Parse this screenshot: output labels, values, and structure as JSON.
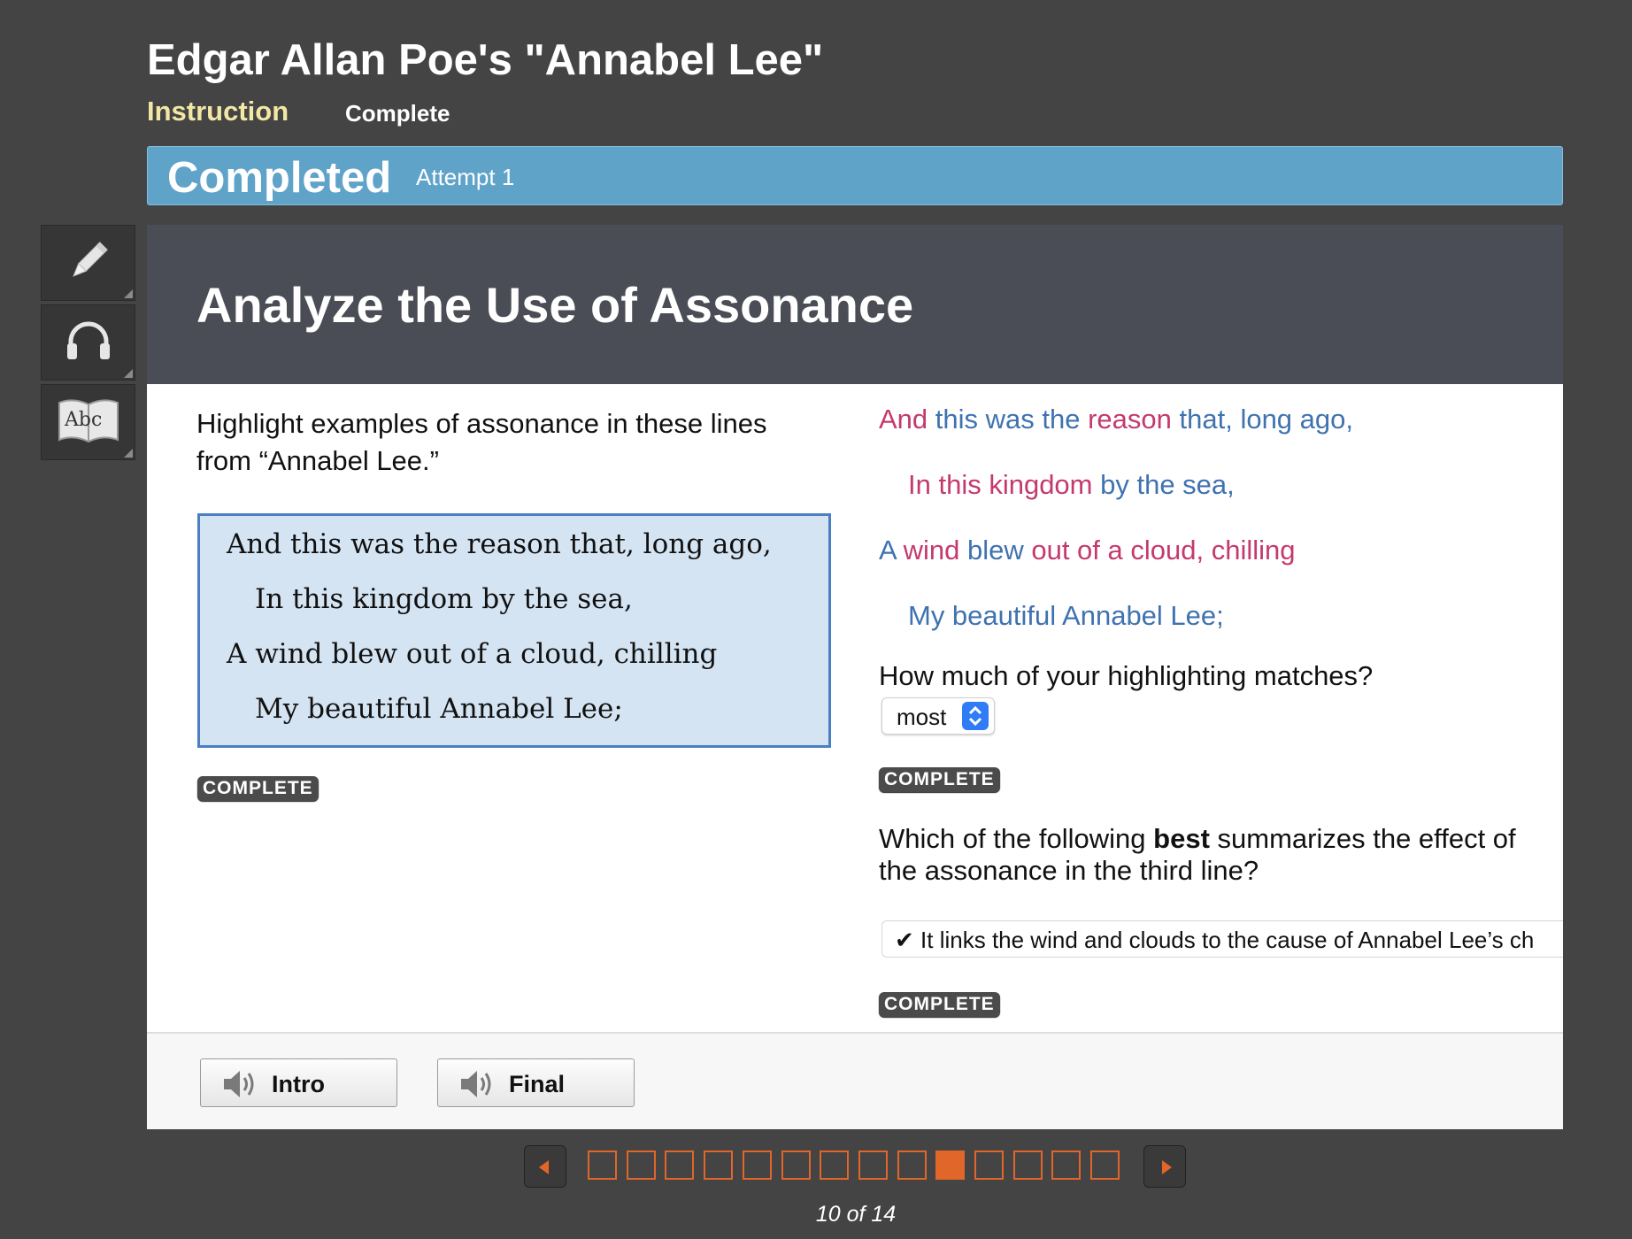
{
  "header": {
    "title": "Edgar Allan Poe's \"Annabel Lee\"",
    "tabs": [
      {
        "label": "Instruction",
        "active": true
      },
      {
        "label": "Complete",
        "active": false
      }
    ]
  },
  "status": {
    "title": "Completed",
    "attempt": "Attempt 1",
    "color": "#5fa3c9"
  },
  "toolbar": {
    "tools": [
      {
        "icon": "pencil-icon"
      },
      {
        "icon": "headphones-icon"
      },
      {
        "icon": "dictionary-icon",
        "glyph": "Abc"
      }
    ]
  },
  "lesson": {
    "title": "Analyze the Use of Assonance",
    "instruction": "Highlight examples of assonance in these lines from “Annabel Lee.”",
    "poem_lines": [
      "And this was the reason that, long ago,",
      "In this kingdom by the sea,",
      "A wind blew out of a cloud, chilling",
      "My beautiful Annabel Lee;"
    ],
    "complete_badge": "COMPLETE"
  },
  "highlighted_answer": {
    "colors": {
      "blue": "#3f72b0",
      "pink": "#c43a6c"
    },
    "lines": [
      [
        {
          "text": "And",
          "color": "pink"
        },
        {
          "text": " this was the ",
          "color": "blue"
        },
        {
          "text": "reason",
          "color": "pink"
        },
        {
          "text": " that,",
          "color": "blue"
        },
        {
          "text": " long ago,",
          "color": "blue"
        }
      ],
      [
        {
          "text": "In this kingdom",
          "color": "pink"
        },
        {
          "text": " by the sea,",
          "color": "blue"
        }
      ],
      [
        {
          "text": "A",
          "color": "blue"
        },
        {
          "text": " wind",
          "color": "pink"
        },
        {
          "text": " blew",
          "color": "blue"
        },
        {
          "text": " out of a cloud,",
          "color": "pink"
        },
        {
          "text": " chilling",
          "color": "pink"
        }
      ],
      [
        {
          "text": "My beautiful Annabel Lee;",
          "color": "blue"
        }
      ]
    ]
  },
  "question1": {
    "text": "How much of your highlighting matches?",
    "selected": "most",
    "badge": "COMPLETE"
  },
  "question2": {
    "text_before": "Which of the following ",
    "text_bold": "best",
    "text_after": " summarizes the effect of the assonance in the third line?",
    "answer_check": "✔",
    "answer": "It links the wind and clouds to the cause of Annabel Lee’s ch",
    "badge": "COMPLETE"
  },
  "footer": {
    "intro_label": "Intro",
    "final_label": "Final"
  },
  "pager": {
    "total": 14,
    "current": 10,
    "indicator": "10 of 14",
    "accent": "#e1662a"
  }
}
